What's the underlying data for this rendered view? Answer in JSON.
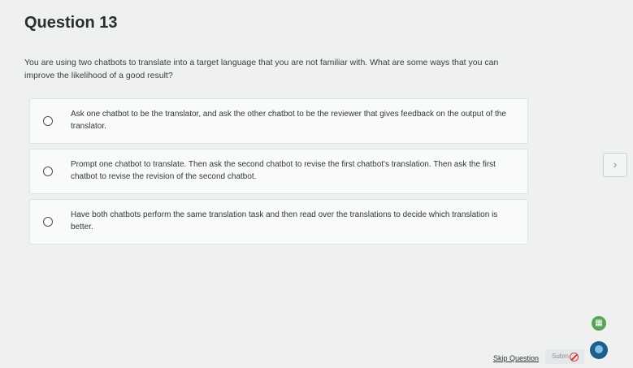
{
  "question": {
    "title": "Question 13",
    "prompt": "You are using two chatbots to translate into a target language that you are not familiar with. What are some ways that you can improve the likelihood of a good result?"
  },
  "options": [
    {
      "label": "Ask one chatbot to be the translator, and ask the other chatbot to be the reviewer that gives feedback on the output of the translator."
    },
    {
      "label": "Prompt one chatbot to translate. Then ask the second chatbot to revise the first chatbot's translation. Then ask the first chatbot to revise the revision of the second chatbot."
    },
    {
      "label": "Have both chatbots perform the same translation task and then read over the translations to decide which translation is better."
    }
  ],
  "footer": {
    "skip_label": "Skip Question",
    "submit_label": "Subm"
  },
  "icons": {
    "side_nav": "chevron-right-icon",
    "calculator": "calculator-icon",
    "submit_disabled": "no-entry-icon",
    "assistant": "assistant-icon"
  }
}
